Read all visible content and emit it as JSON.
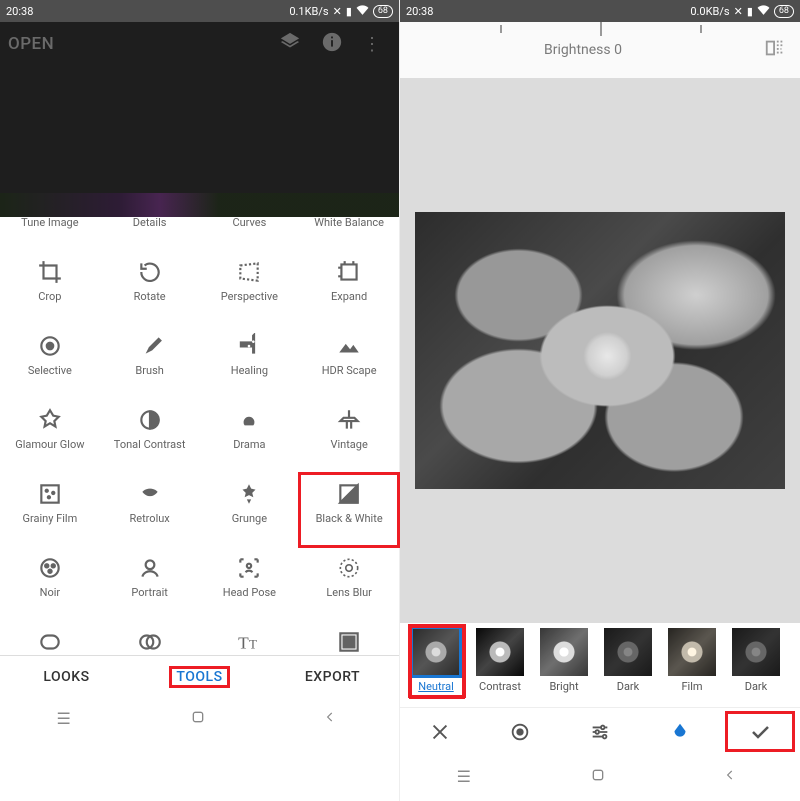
{
  "status": {
    "time": "20:38",
    "speed_left": "0.1KB/s",
    "speed_right": "0.0KB/s",
    "battery": "68"
  },
  "left": {
    "open": "OPEN",
    "tools_header": [
      "Tune Image",
      "Details",
      "Curves",
      "White Balance"
    ],
    "rowA": [
      "Crop",
      "Rotate",
      "Perspective",
      "Expand"
    ],
    "rowB": [
      "Selective",
      "Brush",
      "Healing",
      "HDR Scape"
    ],
    "rowC": [
      "Glamour Glow",
      "Tonal Contrast",
      "Drama",
      "Vintage"
    ],
    "rowD": [
      "Grainy Film",
      "Retrolux",
      "Grunge",
      "Black & White"
    ],
    "rowE": [
      "Noir",
      "Portrait",
      "Head Pose",
      "Lens Blur"
    ],
    "tabs": {
      "looks": "LOOKS",
      "tools": "TOOLS",
      "export": "EXPORT"
    }
  },
  "right": {
    "adjust_label": "Brightness 0",
    "filters": [
      "Neutral",
      "Contrast",
      "Bright",
      "Dark",
      "Film",
      "Dark"
    ]
  }
}
